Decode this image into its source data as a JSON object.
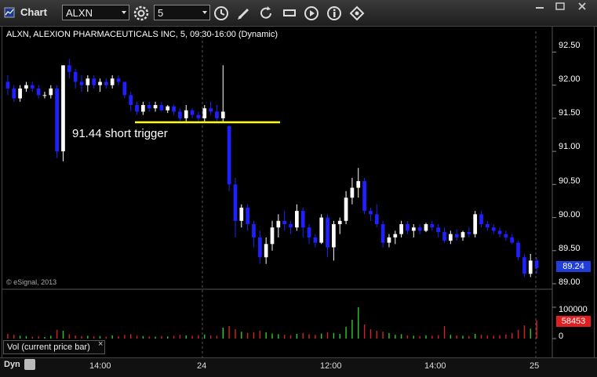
{
  "window": {
    "title": "Chart",
    "symbol": "ALXN",
    "interval": "5"
  },
  "chart": {
    "title": "ALXN, ALEXION PHARMACEUTICALS INC, 5, 09:30-16:00 (Dynamic)",
    "copyright": "© eSignal, 2013",
    "annotation": "91.44 short trigger",
    "price_labels": [
      "92.50",
      "92.00",
      "91.50",
      "91.00",
      "90.50",
      "90.00",
      "89.50",
      "89.00"
    ],
    "last_price": "89.24",
    "volume_pane_label": "Vol (current price bar)",
    "volume_close": "×",
    "volume_labels": [
      "100000",
      "50000",
      "0"
    ],
    "volume_last": "58453",
    "x_labels": [
      "14:00",
      "24",
      "12:00",
      "14:00",
      "25"
    ],
    "dyn_label": "Dyn"
  },
  "colors": {
    "up": "#ffffff",
    "down": "#2020ff",
    "trigger_line": "#ffff00",
    "vol_up": "#2ec82e",
    "vol_down": "#d82020"
  },
  "chart_data": {
    "type": "candlestick",
    "ylim": [
      89.0,
      92.6
    ],
    "trigger_level": 91.44,
    "candles": [
      [
        92.05,
        92.15,
        91.85,
        91.95
      ],
      [
        91.95,
        92.0,
        91.75,
        91.8
      ],
      [
        91.8,
        92.0,
        91.75,
        91.95
      ],
      [
        91.95,
        92.05,
        91.9,
        92.0
      ],
      [
        92.0,
        92.05,
        91.9,
        91.95
      ],
      [
        91.95,
        92.0,
        91.8,
        91.85
      ],
      [
        91.85,
        91.9,
        91.8,
        91.85
      ],
      [
        91.85,
        92.0,
        91.8,
        91.95
      ],
      [
        91.95,
        92.0,
        90.9,
        91.0
      ],
      [
        91.0,
        92.3,
        90.85,
        92.3
      ],
      [
        92.3,
        92.4,
        92.1,
        92.2
      ],
      [
        92.2,
        92.25,
        91.95,
        92.05
      ],
      [
        92.05,
        92.15,
        91.9,
        92.0
      ],
      [
        92.0,
        92.15,
        91.9,
        92.1
      ],
      [
        92.1,
        92.15,
        91.95,
        92.0
      ],
      [
        92.0,
        92.1,
        91.9,
        92.05
      ],
      [
        92.05,
        92.1,
        91.95,
        92.0
      ],
      [
        92.0,
        92.15,
        91.95,
        92.1
      ],
      [
        92.1,
        92.15,
        92.0,
        92.05
      ],
      [
        92.05,
        92.0,
        91.8,
        91.85
      ],
      [
        91.85,
        91.9,
        91.6,
        91.7
      ],
      [
        91.7,
        91.75,
        91.55,
        91.6
      ],
      [
        91.6,
        91.75,
        91.55,
        91.7
      ],
      [
        91.7,
        91.75,
        91.6,
        91.65
      ],
      [
        91.65,
        91.75,
        91.6,
        91.7
      ],
      [
        91.7,
        91.75,
        91.6,
        91.62
      ],
      [
        91.62,
        91.7,
        91.58,
        91.68
      ],
      [
        91.68,
        91.7,
        91.55,
        91.6
      ],
      [
        91.6,
        91.65,
        91.45,
        91.5
      ],
      [
        91.5,
        91.7,
        91.45,
        91.62
      ],
      [
        91.62,
        91.65,
        91.5,
        91.55
      ],
      [
        91.55,
        91.6,
        91.45,
        91.5
      ],
      [
        91.5,
        91.7,
        91.45,
        91.65
      ],
      [
        91.65,
        91.75,
        91.55,
        91.6
      ],
      [
        91.6,
        91.7,
        91.45,
        91.5
      ],
      [
        91.5,
        92.3,
        91.45,
        91.6
      ],
      [
        91.38,
        91.4,
        90.4,
        90.5
      ],
      [
        90.5,
        90.6,
        89.7,
        89.95
      ],
      [
        89.95,
        90.2,
        89.85,
        90.15
      ],
      [
        90.15,
        90.2,
        89.8,
        89.9
      ],
      [
        89.9,
        89.95,
        89.55,
        89.7
      ],
      [
        89.7,
        89.8,
        89.3,
        89.4
      ],
      [
        89.4,
        89.7,
        89.3,
        89.6
      ],
      [
        89.6,
        89.95,
        89.5,
        89.85
      ],
      [
        89.85,
        90.05,
        89.7,
        89.95
      ],
      [
        89.95,
        90.1,
        89.8,
        89.9
      ],
      [
        89.9,
        89.95,
        89.75,
        89.85
      ],
      [
        89.85,
        90.2,
        89.8,
        90.1
      ],
      [
        90.1,
        90.15,
        89.7,
        89.85
      ],
      [
        89.85,
        89.9,
        89.6,
        89.7
      ],
      [
        89.7,
        89.75,
        89.55,
        89.62
      ],
      [
        89.62,
        90.05,
        89.6,
        90.0
      ],
      [
        90.0,
        90.05,
        89.4,
        89.55
      ],
      [
        89.55,
        89.95,
        89.35,
        89.9
      ],
      [
        89.9,
        90.0,
        89.75,
        89.95
      ],
      [
        89.95,
        90.4,
        89.9,
        90.3
      ],
      [
        90.3,
        90.6,
        90.2,
        90.45
      ],
      [
        90.45,
        90.75,
        90.3,
        90.55
      ],
      [
        90.55,
        90.6,
        90.05,
        90.1
      ],
      [
        90.1,
        90.15,
        89.95,
        90.05
      ],
      [
        90.05,
        90.2,
        89.85,
        89.9
      ],
      [
        89.9,
        89.95,
        89.55,
        89.62
      ],
      [
        89.62,
        89.75,
        89.55,
        89.7
      ],
      [
        89.7,
        89.8,
        89.6,
        89.75
      ],
      [
        89.75,
        89.95,
        89.7,
        89.9
      ],
      [
        89.9,
        89.95,
        89.75,
        89.8
      ],
      [
        89.8,
        89.9,
        89.7,
        89.85
      ],
      [
        89.85,
        89.9,
        89.75,
        89.8
      ],
      [
        89.8,
        89.92,
        89.78,
        89.9
      ],
      [
        89.9,
        89.95,
        89.8,
        89.85
      ],
      [
        89.85,
        89.9,
        89.7,
        89.78
      ],
      [
        89.78,
        89.85,
        89.62,
        89.65
      ],
      [
        89.65,
        89.8,
        89.6,
        89.75
      ],
      [
        89.75,
        89.82,
        89.65,
        89.7
      ],
      [
        89.7,
        89.8,
        89.65,
        89.78
      ],
      [
        89.78,
        89.85,
        89.7,
        89.75
      ],
      [
        89.75,
        90.1,
        89.7,
        90.05
      ],
      [
        90.05,
        90.1,
        89.85,
        89.9
      ],
      [
        89.9,
        89.95,
        89.8,
        89.85
      ],
      [
        89.85,
        89.9,
        89.75,
        89.8
      ],
      [
        89.8,
        89.85,
        89.7,
        89.75
      ],
      [
        89.75,
        89.8,
        89.65,
        89.7
      ],
      [
        89.7,
        89.75,
        89.6,
        89.62
      ],
      [
        89.62,
        89.65,
        89.35,
        89.4
      ],
      [
        89.4,
        89.45,
        89.1,
        89.15
      ],
      [
        89.15,
        89.45,
        89.1,
        89.35
      ],
      [
        89.35,
        89.4,
        89.15,
        89.24
      ]
    ],
    "volumes": [
      15000,
      12000,
      9000,
      8000,
      6000,
      7000,
      5000,
      9000,
      28000,
      25000,
      14000,
      10000,
      8000,
      9000,
      7000,
      8000,
      6000,
      10000,
      7000,
      12000,
      14000,
      9000,
      8000,
      7000,
      6000,
      8000,
      7000,
      9000,
      12000,
      10000,
      9000,
      11000,
      13000,
      10000,
      9000,
      35000,
      40000,
      30000,
      22000,
      18000,
      20000,
      25000,
      20000,
      16000,
      14000,
      12000,
      11000,
      15000,
      18000,
      14000,
      12000,
      16000,
      20000,
      18000,
      15000,
      38000,
      60000,
      100000,
      45000,
      30000,
      25000,
      22000,
      18000,
      12000,
      14000,
      10000,
      9000,
      8000,
      10000,
      9000,
      11000,
      40000,
      12000,
      10000,
      9000,
      8000,
      15000,
      12000,
      10000,
      9000,
      11000,
      13000,
      18000,
      28000,
      42000,
      32000,
      58453
    ]
  }
}
